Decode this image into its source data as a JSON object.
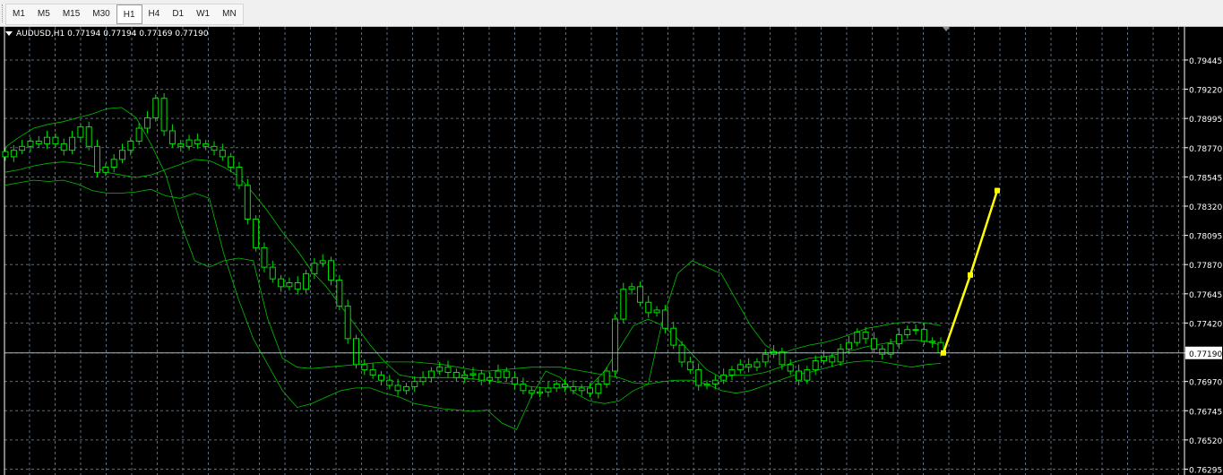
{
  "toolbar": {
    "timeframes": [
      "M1",
      "M5",
      "M15",
      "M30",
      "H1",
      "H4",
      "D1",
      "W1",
      "MN"
    ],
    "active": "H1"
  },
  "chart": {
    "symbol_label": "AUDUSD,H1",
    "ohlc_label": "0.77194 0.77194 0.77169 0.77190",
    "colors": {
      "background": "#000000",
      "grid": "#5a6b7c",
      "candles": "#00e000",
      "bands": "#00c000",
      "forecast": "#ffff00",
      "price_line": "#a0b4c8"
    }
  },
  "chart_data": {
    "type": "line",
    "title": "",
    "symbol": "AUDUSD",
    "timeframe": "H1",
    "ylim": [
      0.7625,
      0.797
    ],
    "yticks": [
      0.79445,
      0.7922,
      0.78995,
      0.7877,
      0.78545,
      0.7832,
      0.78095,
      0.7787,
      0.77645,
      0.7742,
      0.7719,
      0.7697,
      0.76745,
      0.7652,
      0.76295
    ],
    "ytick_labels": [
      "0.79445",
      "0.79220",
      "0.78995",
      "0.78770",
      "0.78545",
      "0.78320",
      "0.78095",
      "0.77870",
      "0.77645",
      "0.77420",
      "0.77190",
      "0.76970",
      "0.76745",
      "0.76520",
      "0.76295"
    ],
    "current_price": 0.7719,
    "current_price_label": "0.77190",
    "grid": true,
    "series": [
      {
        "values": [
          0.787,
          0.7875,
          0.7878,
          0.7882,
          0.788,
          0.7885,
          0.788,
          0.7875,
          0.7885,
          0.7893,
          0.7878,
          0.7858,
          0.7862,
          0.7868,
          0.7875,
          0.7882,
          0.7892,
          0.79,
          0.7915,
          0.789,
          0.788,
          0.7878,
          0.7883,
          0.788,
          0.7878,
          0.7875,
          0.787,
          0.7862,
          0.7848,
          0.7822,
          0.78,
          0.7785,
          0.7776,
          0.777,
          0.7773,
          0.7768,
          0.778,
          0.7788,
          0.779,
          0.7775,
          0.7755,
          0.773,
          0.771,
          0.7706,
          0.7702,
          0.7698,
          0.7694,
          0.769,
          0.7693,
          0.7697,
          0.77,
          0.7705,
          0.7708,
          0.7704,
          0.77,
          0.7702,
          0.7703,
          0.7698,
          0.77,
          0.7705,
          0.77,
          0.7695,
          0.769,
          0.7688,
          0.7689,
          0.7692,
          0.7695,
          0.7693,
          0.769,
          0.7692,
          0.7688,
          0.7695,
          0.7705,
          0.7745,
          0.7768,
          0.777,
          0.7758,
          0.775,
          0.7752,
          0.7738,
          0.7725,
          0.7712,
          0.7706,
          0.7694,
          0.7695,
          0.7698,
          0.7702,
          0.7706,
          0.771,
          0.7708,
          0.7712,
          0.7718,
          0.772,
          0.771,
          0.7705,
          0.7698,
          0.7706,
          0.7713,
          0.7716,
          0.7712,
          0.7722,
          0.7727,
          0.7735,
          0.773,
          0.7722,
          0.7718,
          0.7726,
          0.7733,
          0.7737,
          0.7737,
          0.7728,
          0.7727,
          0.7719
        ]
      },
      {
        "values": [
          0.7877,
          0.7885,
          0.7892,
          0.7895,
          0.7897,
          0.79,
          0.7903,
          0.7907,
          0.7908,
          0.79,
          0.788,
          0.7857,
          0.782,
          0.779,
          0.7785,
          0.779,
          0.7792,
          0.779,
          0.7745,
          0.7715,
          0.7708,
          0.7707,
          0.7708,
          0.7709,
          0.771,
          0.7711,
          0.7712,
          0.7712,
          0.7712,
          0.7711,
          0.771,
          0.7708,
          0.7706,
          0.7705,
          0.7706,
          0.7707,
          0.7708,
          0.7708,
          0.7708,
          0.7706,
          0.7704,
          0.7702,
          0.77,
          0.7696,
          0.7695,
          0.7745,
          0.778,
          0.779,
          0.7785,
          0.778,
          0.776,
          0.774,
          0.7725,
          0.7718,
          0.7722,
          0.7725,
          0.7727,
          0.773,
          0.7734,
          0.7738,
          0.774,
          0.7742,
          0.7743,
          0.7742,
          0.774
        ]
      },
      {
        "values": [
          0.7858,
          0.786,
          0.7863,
          0.7865,
          0.7866,
          0.7865,
          0.7863,
          0.7858,
          0.7856,
          0.7854,
          0.7856,
          0.786,
          0.7864,
          0.7868,
          0.7867,
          0.7862,
          0.7855,
          0.7842,
          0.7828,
          0.7812,
          0.7798,
          0.7782,
          0.777,
          0.7755,
          0.774,
          0.7725,
          0.7712,
          0.7702,
          0.77,
          0.77,
          0.77,
          0.77,
          0.7699,
          0.7698,
          0.7696,
          0.7695,
          0.7693,
          0.7692,
          0.7692,
          0.7693,
          0.7693,
          0.7705,
          0.7722,
          0.774,
          0.7745,
          0.774,
          0.773,
          0.7718,
          0.7706,
          0.77,
          0.7702,
          0.7702,
          0.7704,
          0.7708,
          0.7712,
          0.7715,
          0.7716,
          0.7718,
          0.7721,
          0.7724,
          0.7726,
          0.7728,
          0.7729,
          0.7728,
          0.7725
        ]
      },
      {
        "values": [
          0.7848,
          0.785,
          0.7852,
          0.7851,
          0.7852,
          0.7849,
          0.7844,
          0.7842,
          0.7842,
          0.7843,
          0.7845,
          0.784,
          0.7838,
          0.7842,
          0.7838,
          0.7795,
          0.776,
          0.773,
          0.771,
          0.769,
          0.7677,
          0.768,
          0.7685,
          0.769,
          0.7692,
          0.7692,
          0.7688,
          0.7685,
          0.768,
          0.7678,
          0.7676,
          0.7675,
          0.7674,
          0.7675,
          0.7665,
          0.766,
          0.7685,
          0.7705,
          0.77,
          0.7688,
          0.7682,
          0.768,
          0.7682,
          0.769,
          0.7695,
          0.7697,
          0.7698,
          0.7698,
          0.7695,
          0.769,
          0.7688,
          0.769,
          0.7694,
          0.7698,
          0.7702,
          0.7704,
          0.7707,
          0.771,
          0.7712,
          0.7713,
          0.7712,
          0.771,
          0.7708,
          0.771,
          0.7711
        ]
      },
      {
        "values": [
          0.7719,
          0.7779,
          0.7844
        ]
      }
    ]
  }
}
